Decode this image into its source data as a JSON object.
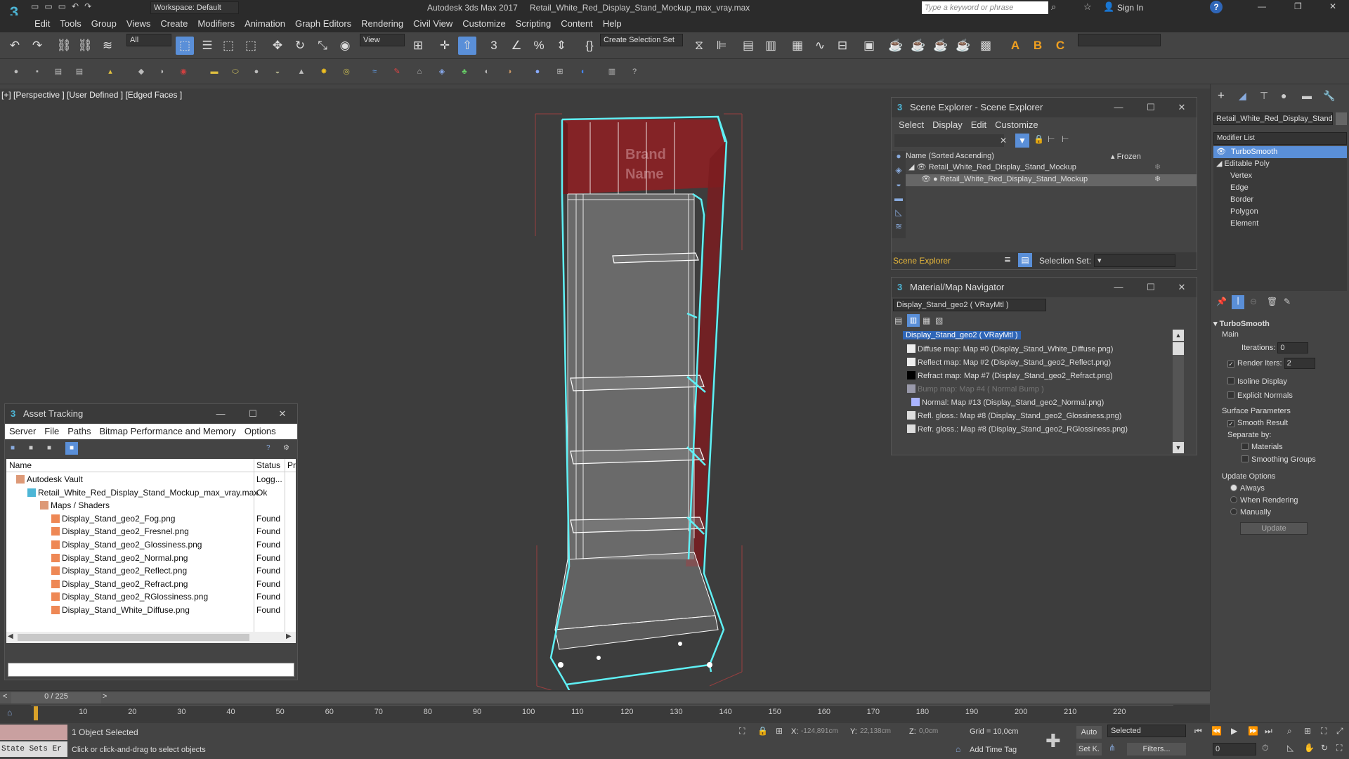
{
  "titlebar": {
    "app_title": "Autodesk 3ds Max 2017",
    "file_name": "Retail_White_Red_Display_Stand_Mockup_max_vray.max",
    "workspace": "Workspace: Default",
    "search_placeholder": "Type a keyword or phrase",
    "sign_in": "Sign In"
  },
  "menu": [
    "Edit",
    "Tools",
    "Group",
    "Views",
    "Create",
    "Modifiers",
    "Animation",
    "Graph Editors",
    "Rendering",
    "Civil View",
    "Customize",
    "Scripting",
    "Content",
    "Help"
  ],
  "toolbar": {
    "filter_value": "All",
    "refcoord_value": "View",
    "selection_set_value": "Create Selection Set"
  },
  "viewport": {
    "label_plus": "[+]",
    "label_view": "[Perspective ]",
    "label_shading": "[User Defined ]",
    "label_faces": "[Edged Faces ]",
    "brand_line1": "Brand",
    "brand_line2": "Name"
  },
  "scene_explorer": {
    "title": "Scene Explorer - Scene Explorer",
    "menu": [
      "Select",
      "Display",
      "Edit",
      "Customize"
    ],
    "col_name": "Name (Sorted Ascending)",
    "col_frozen": "▴ Frozen",
    "rows": [
      "Retail_White_Red_Display_Stand_Mockup",
      "Retail_White_Red_Display_Stand_Mockup"
    ],
    "footer_label": "Scene Explorer",
    "selection_set_label": "Selection Set:"
  },
  "material_navigator": {
    "title": "Material/Map Navigator",
    "current": "Display_Stand_geo2  ( VRayMtl )",
    "items": [
      "Display_Stand_geo2  ( VRayMtl )",
      "Diffuse map: Map #0 (Display_Stand_White_Diffuse.png)",
      "Reflect map: Map #2 (Display_Stand_geo2_Reflect.png)",
      "Refract map: Map #7 (Display_Stand_geo2_Refract.png)",
      "Bump map: Map #4  ( Normal Bump )",
      "Normal: Map #13 (Display_Stand_geo2_Normal.png)",
      "Refl. gloss.: Map #8 (Display_Stand_geo2_Glossiness.png)",
      "Refr. gloss.: Map #8 (Display_Stand_geo2_RGlossiness.png)"
    ]
  },
  "asset_tracking": {
    "title": "Asset Tracking",
    "menu": [
      "Server",
      "File",
      "Paths",
      "Bitmap Performance and Memory",
      "Options"
    ],
    "col_name": "Name",
    "col_status": "Status",
    "col_pr": "Pr",
    "rows": [
      {
        "name": "Autodesk Vault",
        "status": "Logg..."
      },
      {
        "name": "Retail_White_Red_Display_Stand_Mockup_max_vray.max",
        "status": "Ok"
      },
      {
        "name": "Maps / Shaders",
        "status": ""
      },
      {
        "name": "Display_Stand_geo2_Fog.png",
        "status": "Found"
      },
      {
        "name": "Display_Stand_geo2_Fresnel.png",
        "status": "Found"
      },
      {
        "name": "Display_Stand_geo2_Glossiness.png",
        "status": "Found"
      },
      {
        "name": "Display_Stand_geo2_Normal.png",
        "status": "Found"
      },
      {
        "name": "Display_Stand_geo2_Reflect.png",
        "status": "Found"
      },
      {
        "name": "Display_Stand_geo2_Refract.png",
        "status": "Found"
      },
      {
        "name": "Display_Stand_geo2_RGlossiness.png",
        "status": "Found"
      },
      {
        "name": "Display_Stand_White_Diffuse.png",
        "status": "Found"
      }
    ]
  },
  "command_panel": {
    "object_name": "Retail_White_Red_Display_Stand_M",
    "modifier_list": "Modifier List",
    "stack": [
      "TurboSmooth",
      "Editable Poly",
      "Vertex",
      "Edge",
      "Border",
      "Polygon",
      "Element"
    ],
    "rollout_title": "TurboSmooth",
    "main_label": "Main",
    "iterations_label": "Iterations:",
    "iterations_value": "0",
    "render_iters_label": "Render Iters:",
    "render_iters_value": "2",
    "isoline": "Isoline Display",
    "explicit_normals": "Explicit Normals",
    "surface_params": "Surface Parameters",
    "smooth_result": "Smooth Result",
    "separate_by": "Separate by:",
    "materials": "Materials",
    "smoothing_groups": "Smoothing Groups",
    "update_options": "Update Options",
    "always": "Always",
    "when_rendering": "When Rendering",
    "manually": "Manually",
    "update_button": "Update"
  },
  "timeline": {
    "frame_counter": "0 / 225",
    "ticks": [
      "10",
      "20",
      "30",
      "40",
      "50",
      "60",
      "70",
      "80",
      "90",
      "100",
      "110",
      "120",
      "130",
      "140",
      "150",
      "160",
      "170",
      "180",
      "190",
      "200",
      "210",
      "220"
    ]
  },
  "status": {
    "state_sets": "State Sets Er",
    "selected": "1 Object Selected",
    "prompt": "Click or click-and-drag to select objects",
    "x_label": "X:",
    "x_value": "-124,891cm",
    "y_label": "Y:",
    "y_value": "22,138cm",
    "z_label": "Z:",
    "z_value": "0,0cm",
    "grid": "Grid = 10,0cm",
    "add_time_tag": "Add Time Tag",
    "auto": "Auto",
    "set_k": "Set K.",
    "selected_dd": "Selected",
    "filters": "Filters...",
    "frame_value": "0"
  },
  "colors": {
    "accent_blue": "#5a8fd8",
    "selection_cyan": "#5ff0f5",
    "brand_red": "#8c2024"
  }
}
